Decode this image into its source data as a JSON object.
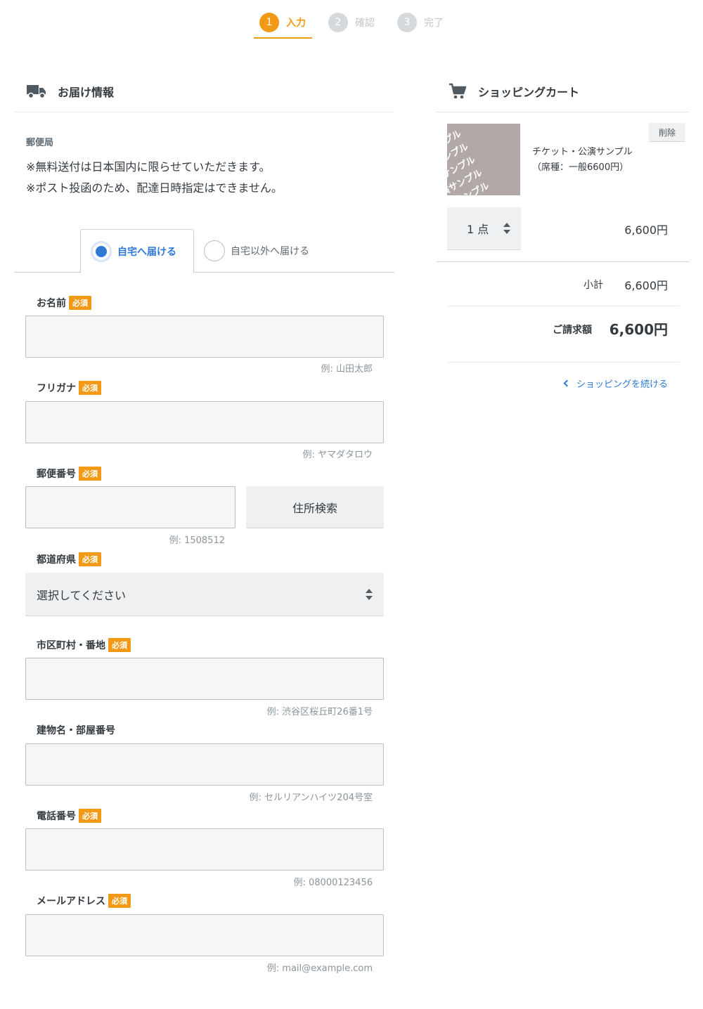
{
  "steps": [
    {
      "num": "1",
      "label": "入力"
    },
    {
      "num": "2",
      "label": "確認"
    },
    {
      "num": "3",
      "label": "完了"
    }
  ],
  "delivery": {
    "title": "お届け情報",
    "method": "郵便局",
    "notes": [
      "※無料送付は日本国内に限らせていただきます。",
      "※ポスト投函のため、配達日時指定はできません。"
    ],
    "tabs": {
      "home": "自宅へ届ける",
      "other": "自宅以外へ届ける"
    }
  },
  "form": {
    "required_badge": "必須",
    "name": {
      "label": "お名前",
      "hint": "例: 山田太郎"
    },
    "kana": {
      "label": "フリガナ",
      "hint": "例: ヤマダタロウ"
    },
    "zip": {
      "label": "郵便番号",
      "hint": "例: 1508512",
      "button": "住所検索"
    },
    "pref": {
      "label": "都道府県",
      "value": "選択してください"
    },
    "city": {
      "label": "市区町村・番地",
      "hint": "例: 渋谷区桜丘町26番1号"
    },
    "building": {
      "label": "建物名・部屋番号",
      "hint": "例: セルリアンハイツ204号室"
    },
    "phone": {
      "label": "電話番号",
      "hint": "例: 08000123456"
    },
    "email": {
      "label": "メールアドレス",
      "hint": "例: mail@example.com"
    }
  },
  "cart": {
    "title": "ショッピングカート",
    "item": {
      "name_line1": "チケット・公演サンプル",
      "name_line2": "（席種：一般6600円）",
      "thumb_text": "公演サンプル",
      "delete": "削除",
      "qty": "1 点",
      "price": "6,600円"
    },
    "subtotal_label": "小計",
    "subtotal": "6,600円",
    "total_label": "ご請求額",
    "total": "6,600円",
    "continue": "ショッピングを続ける"
  },
  "colors": {
    "accent": "#f29a16",
    "link": "#2e79d6"
  }
}
